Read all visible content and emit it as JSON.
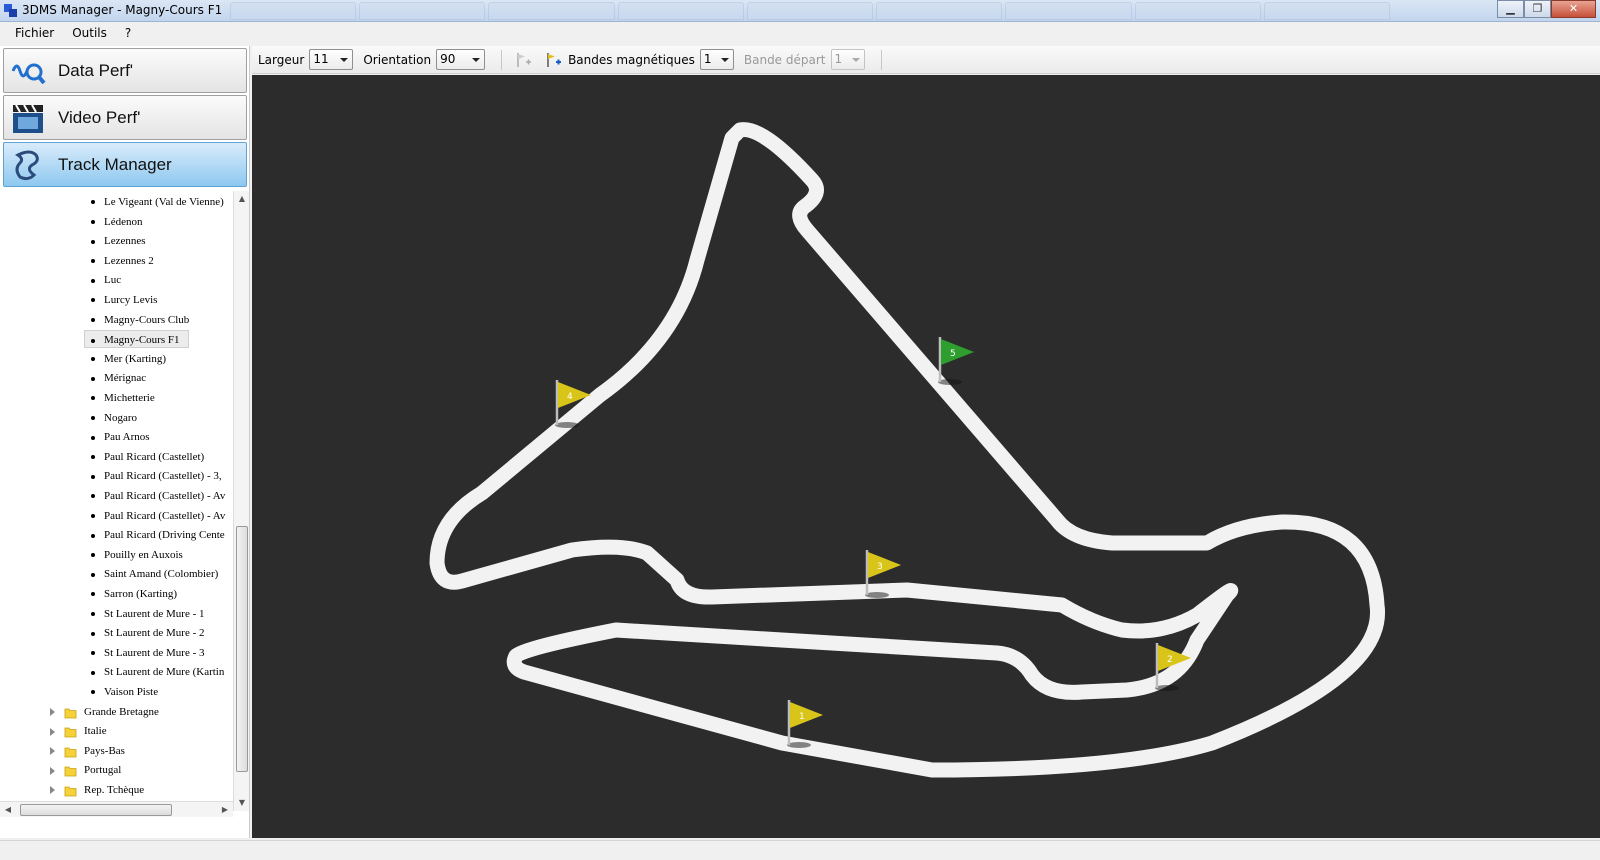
{
  "window": {
    "title": "3DMS Manager - Magny-Cours F1",
    "minimize": "▁",
    "maximize": "❐",
    "close": "✕"
  },
  "menu": [
    "Fichier",
    "Outils",
    "?"
  ],
  "nav": [
    {
      "label": "Data Perf'",
      "icon": "wave-magnifier-icon"
    },
    {
      "label": "Video Perf'",
      "icon": "clapperboard-icon"
    },
    {
      "label": "Track Manager",
      "icon": "track-outline-icon"
    }
  ],
  "tree": {
    "tracks": [
      "Le Vigeant (Val de Vienne)",
      "Lédenon",
      "Lezennes",
      "Lezennes 2",
      "Luc",
      "Lurcy Levis",
      "Magny-Cours Club",
      "Magny-Cours F1",
      "Mer (Karting)",
      "Mérignac",
      "Michetterie",
      "Nogaro",
      "Pau Arnos",
      "Paul Ricard (Castellet)",
      "Paul Ricard (Castellet) - 3,",
      "Paul Ricard (Castellet) - Av",
      "Paul Ricard (Castellet) - Av",
      "Paul Ricard (Driving Cente",
      "Pouilly en Auxois",
      "Saint Amand (Colombier)",
      "Sarron (Karting)",
      "St Laurent de Mure - 1",
      "St Laurent de Mure - 2",
      "St Laurent de Mure - 3",
      "St Laurent de Mure (Kartin",
      "Vaison Piste"
    ],
    "selected": "Magny-Cours F1",
    "countries": [
      "Grande Bretagne",
      "Italie",
      "Pays-Bas",
      "Portugal",
      "Rep. Tchèque"
    ]
  },
  "toolbar": {
    "largeur_label": "Largeur",
    "largeur_value": "11",
    "orientation_label": "Orientation",
    "orientation_value": "90",
    "bandes_label": "Bandes magnétiques",
    "bandes_value": "1",
    "bande_depart_label": "Bande départ",
    "bande_depart_value": "1"
  },
  "flags": [
    {
      "num": "1",
      "color": "#d9c51a"
    },
    {
      "num": "2",
      "color": "#d9c51a"
    },
    {
      "num": "3",
      "color": "#d9c51a"
    },
    {
      "num": "4",
      "color": "#d9c51a"
    },
    {
      "num": "5",
      "color": "#2e9e2e"
    }
  ],
  "colors": {
    "canvas_bg": "#2c2c2c",
    "track": "#f2f2f2",
    "nav_active": "#8ec8ef"
  }
}
